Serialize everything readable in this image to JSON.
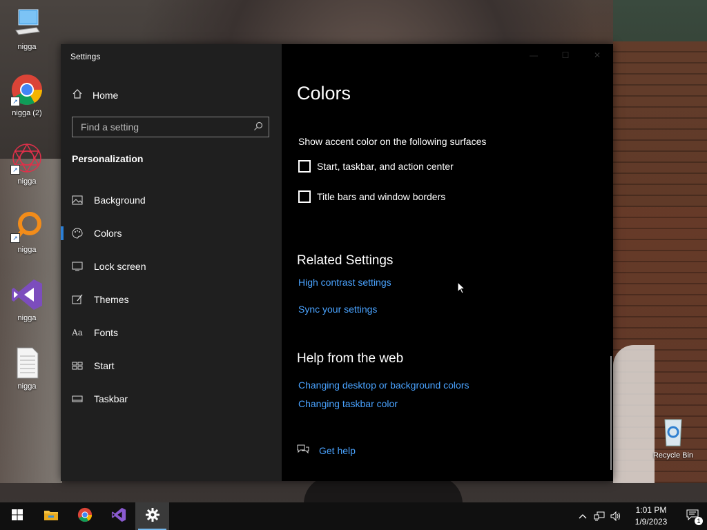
{
  "desktop": {
    "icons": [
      {
        "label": "nigga",
        "icon": "computer-icon"
      },
      {
        "label": "nigga (2)",
        "icon": "chrome-icon"
      },
      {
        "label": "nigga",
        "icon": "spiral-art-icon"
      },
      {
        "label": "nigga",
        "icon": "magnifier-app-icon"
      },
      {
        "label": "nigga",
        "icon": "visual-studio-icon"
      },
      {
        "label": "nigga",
        "icon": "text-document-icon"
      }
    ],
    "recycle_bin": "Recycle Bin"
  },
  "window": {
    "title": "Settings",
    "home_label": "Home",
    "search_placeholder": "Find a setting",
    "section_label": "Personalization",
    "nav_items": [
      {
        "label": "Background",
        "icon": "image-icon"
      },
      {
        "label": "Colors",
        "icon": "palette-icon",
        "active": true
      },
      {
        "label": "Lock screen",
        "icon": "monitor-lock-icon"
      },
      {
        "label": "Themes",
        "icon": "brush-icon"
      },
      {
        "label": "Fonts",
        "icon": "font-icon"
      },
      {
        "label": "Start",
        "icon": "start-grid-icon"
      },
      {
        "label": "Taskbar",
        "icon": "taskbar-icon"
      }
    ]
  },
  "content": {
    "title": "Colors",
    "accent_subheading": "Show accent color on the following surfaces",
    "checkboxes": [
      {
        "label": "Start, taskbar, and action center",
        "checked": false
      },
      {
        "label": "Title bars and window borders",
        "checked": false
      }
    ],
    "related_heading": "Related Settings",
    "related_links": [
      "High contrast settings",
      "Sync your settings"
    ],
    "help_heading": "Help from the web",
    "help_links": [
      "Changing desktop or background colors",
      "Changing taskbar color"
    ],
    "get_help": "Get help"
  },
  "taskbar": {
    "time": "1:01 PM",
    "date": "1/9/2023",
    "notification_count": "1",
    "accent": "#76b9ed"
  },
  "colors": {
    "link": "#4aa3ff",
    "sidebar_bg": "#1f1f1f",
    "content_bg": "#000000",
    "active_indicator": "#2b7fd6"
  }
}
